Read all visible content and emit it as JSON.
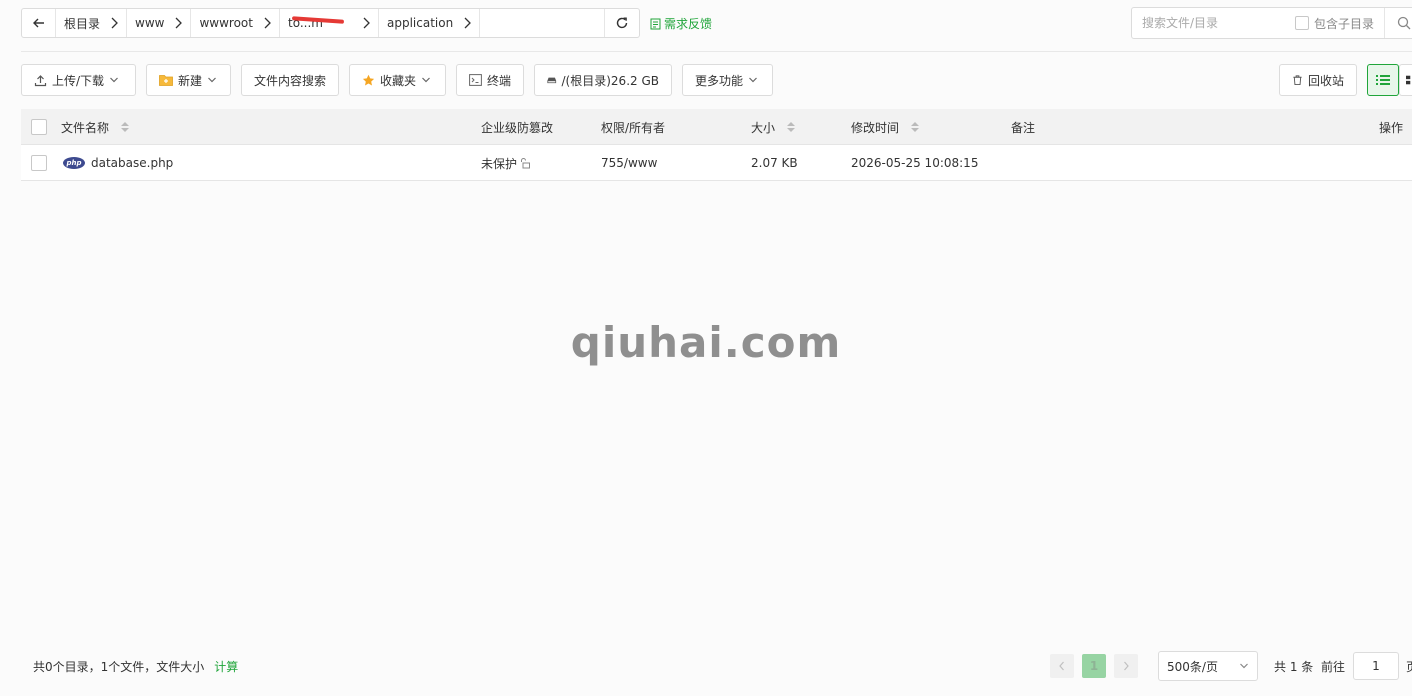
{
  "breadcrumb": {
    "back_icon": "arrow-left-icon",
    "items": [
      "根目录",
      "www",
      "wwwroot",
      "to...m",
      "application"
    ],
    "refresh_icon": "refresh-icon"
  },
  "feedback": {
    "label": "需求反馈",
    "icon": "feedback-icon"
  },
  "search": {
    "placeholder": "搜索文件/目录",
    "subdir_label": "包含子目录",
    "icon": "search-icon"
  },
  "toolbar": {
    "upload_download": "上传/下载",
    "new": "新建",
    "content_search": "文件内容搜索",
    "favorites": "收藏夹",
    "terminal": "终端",
    "disk": "/(根目录)26.2 GB",
    "more": "更多功能",
    "recycle": "回收站"
  },
  "table": {
    "headers": {
      "name": "文件名称",
      "tamper": "企业级防篡改",
      "perm": "权限/所有者",
      "size": "大小",
      "mtime": "修改时间",
      "note": "备注",
      "ops": "操作"
    },
    "rows": [
      {
        "icon": "php-file-icon",
        "name": "database.php",
        "tamper": "未保护",
        "perm": "755/www",
        "size": "2.07 KB",
        "mtime": "2026-05-25 10:08:15",
        "note": ""
      }
    ]
  },
  "watermark": "qiuhai.com",
  "footer": {
    "summary": "共0个目录，1个文件，文件大小",
    "calc": "计算",
    "current_page": "1",
    "per_page": "500条/页",
    "total": "共 1 条",
    "goto_label": "前往",
    "goto_value": "1",
    "page_unit": "页"
  },
  "colors": {
    "accent": "#20a53a",
    "php_badge": "#3d4a8f",
    "redaction": "#e53935"
  }
}
